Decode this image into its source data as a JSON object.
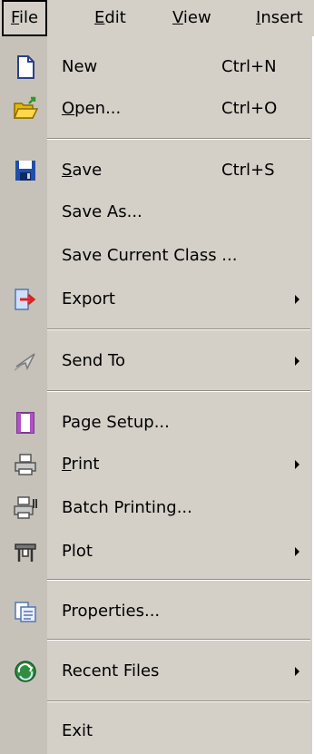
{
  "menubar": {
    "file": {
      "u": "F",
      "rest": "ile"
    },
    "edit": {
      "u": "E",
      "rest": "dit"
    },
    "view": {
      "u": "V",
      "rest": "iew"
    },
    "insert": {
      "u": "I",
      "rest": "nsert"
    }
  },
  "menu": {
    "new": {
      "label": "New",
      "shortcut": "Ctrl+N",
      "icon": "new-document-icon"
    },
    "open": {
      "u": "O",
      "rest": "pen...",
      "shortcut": "Ctrl+O",
      "icon": "open-folder-icon"
    },
    "save": {
      "u": "S",
      "rest": "ave",
      "shortcut": "Ctrl+S",
      "icon": "floppy-disk-icon"
    },
    "save_as": {
      "label": "Save As..."
    },
    "save_current_class": {
      "label": "Save Current Class ..."
    },
    "export": {
      "label": "Export",
      "icon": "export-arrow-icon"
    },
    "send_to": {
      "label": "Send To",
      "icon": "send-plane-icon"
    },
    "page_setup": {
      "label": "Page Setup...",
      "icon": "page-setup-icon"
    },
    "print": {
      "u": "P",
      "rest": "rint",
      "icon": "printer-icon"
    },
    "batch_printing": {
      "label": "Batch Printing...",
      "icon": "batch-printer-icon"
    },
    "plot": {
      "label": "Plot",
      "icon": "plotter-icon"
    },
    "properties": {
      "label": "Properties...",
      "icon": "properties-icon"
    },
    "recent_files": {
      "label": "Recent Files",
      "icon": "recent-files-icon"
    },
    "exit": {
      "label": "Exit"
    }
  },
  "colors": {
    "menu_bg": "#d4d0c8",
    "gutter": "#c6c2ba",
    "accent_blue": "#1f4fa8",
    "accent_red": "#e02020"
  }
}
